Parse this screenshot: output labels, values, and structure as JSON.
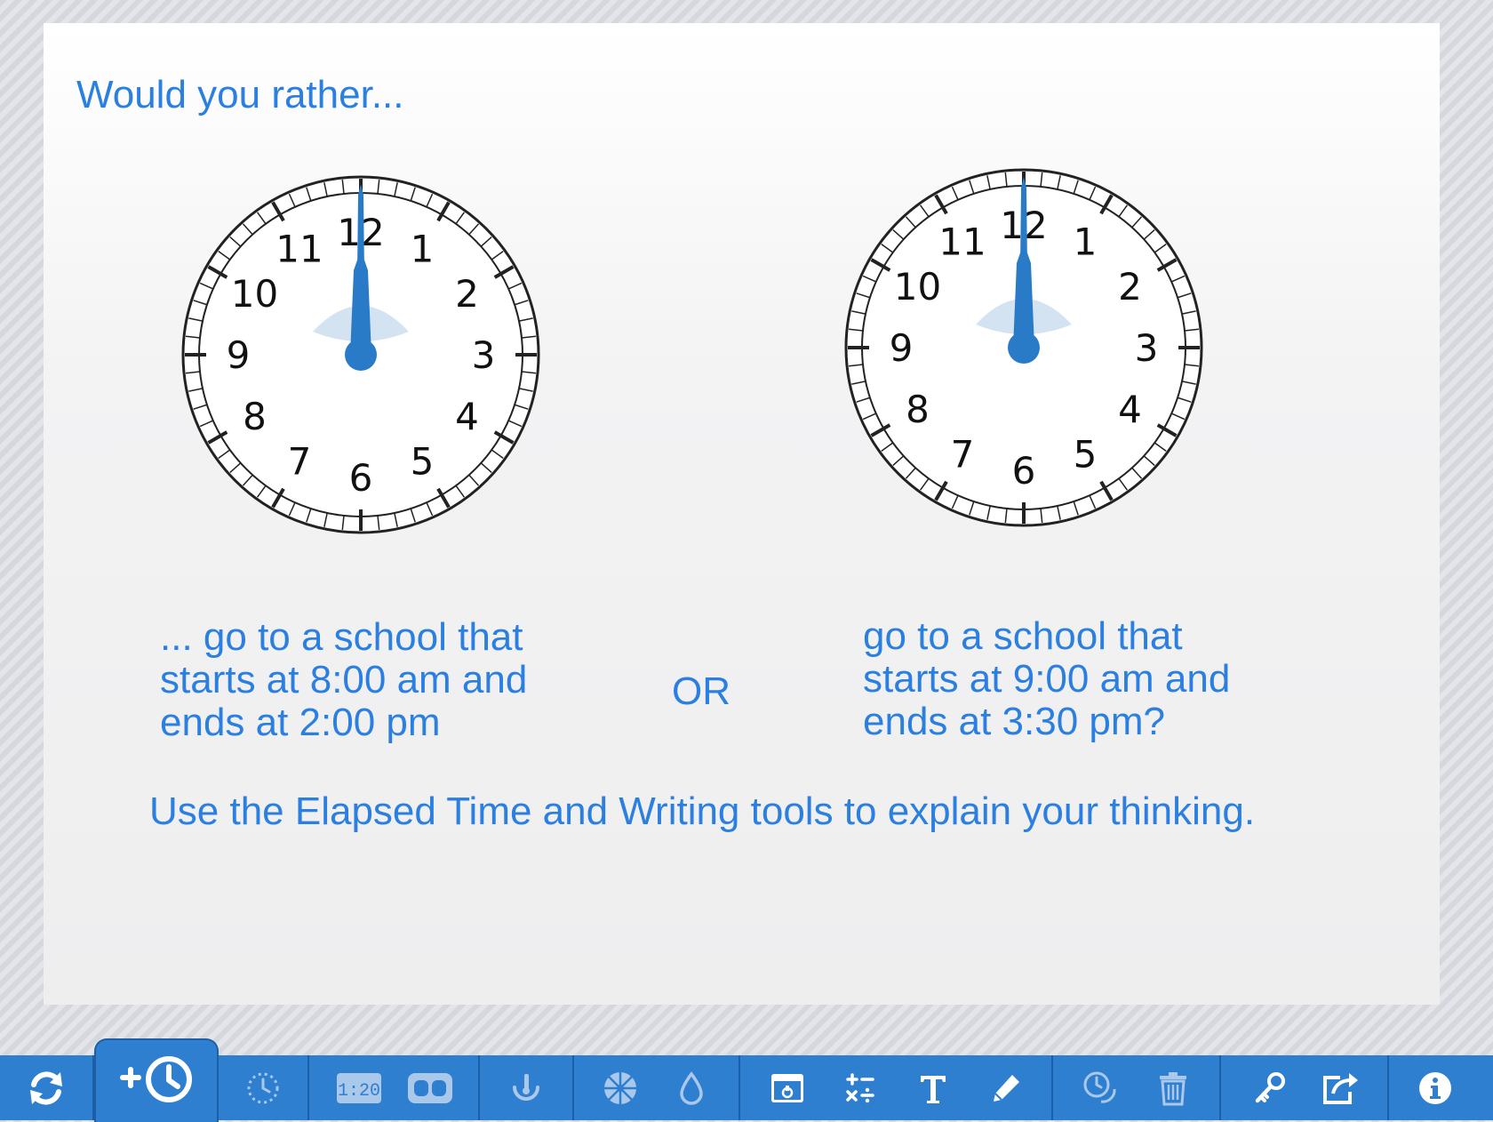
{
  "prompt": {
    "title": "Would you rather...",
    "left_option": [
      "... go to a school that",
      "starts at 8:00 am and",
      "ends at 2:00 pm"
    ],
    "or_label": "OR",
    "right_option": [
      "go to a school that",
      "starts at 9:00 am and",
      "ends at 3:30 pm?"
    ],
    "instruction": "Use the Elapsed Time and Writing tools to explain your thinking."
  },
  "clocks": [
    {
      "numerals": [
        "12",
        "1",
        "2",
        "3",
        "4",
        "5",
        "6",
        "7",
        "8",
        "9",
        "10",
        "11"
      ]
    },
    {
      "numerals": [
        "12",
        "1",
        "2",
        "3",
        "4",
        "5",
        "6",
        "7",
        "8",
        "9",
        "10",
        "11"
      ]
    }
  ],
  "toolbar": {
    "items": [
      {
        "icon": "refresh-icon",
        "active": false,
        "enabled": true
      },
      {
        "icon": "add-clock-icon",
        "active": true,
        "enabled": true
      },
      {
        "icon": "dotted-clock-icon",
        "active": false,
        "enabled": false
      },
      {
        "icon": "digital-time-icon",
        "active": false,
        "enabled": false
      },
      {
        "icon": "toggle-display-icon",
        "active": false,
        "enabled": false
      },
      {
        "icon": "stopwatch-icon",
        "active": false,
        "enabled": false
      },
      {
        "icon": "color-wheel-icon",
        "active": false,
        "enabled": false
      },
      {
        "icon": "fill-drop-icon",
        "active": false,
        "enabled": false
      },
      {
        "icon": "panel-icon",
        "active": false,
        "enabled": true
      },
      {
        "icon": "operations-icon",
        "active": false,
        "enabled": true
      },
      {
        "icon": "text-tool-icon",
        "active": false,
        "enabled": true
      },
      {
        "icon": "pencil-icon",
        "active": false,
        "enabled": true
      },
      {
        "icon": "elapsed-time-icon",
        "active": false,
        "enabled": false
      },
      {
        "icon": "trash-icon",
        "active": false,
        "enabled": false
      },
      {
        "icon": "key-icon",
        "active": false,
        "enabled": true
      },
      {
        "icon": "share-icon",
        "active": false,
        "enabled": true
      },
      {
        "icon": "info-icon",
        "active": false,
        "enabled": true
      }
    ]
  },
  "colors": {
    "accent_text": "#2b7fe0",
    "toolbar_bg": "#2f7fd0",
    "clock_hand": "#2a7bc7",
    "icon_active": "#ffffff",
    "icon_disabled": "#a9c8ea"
  }
}
